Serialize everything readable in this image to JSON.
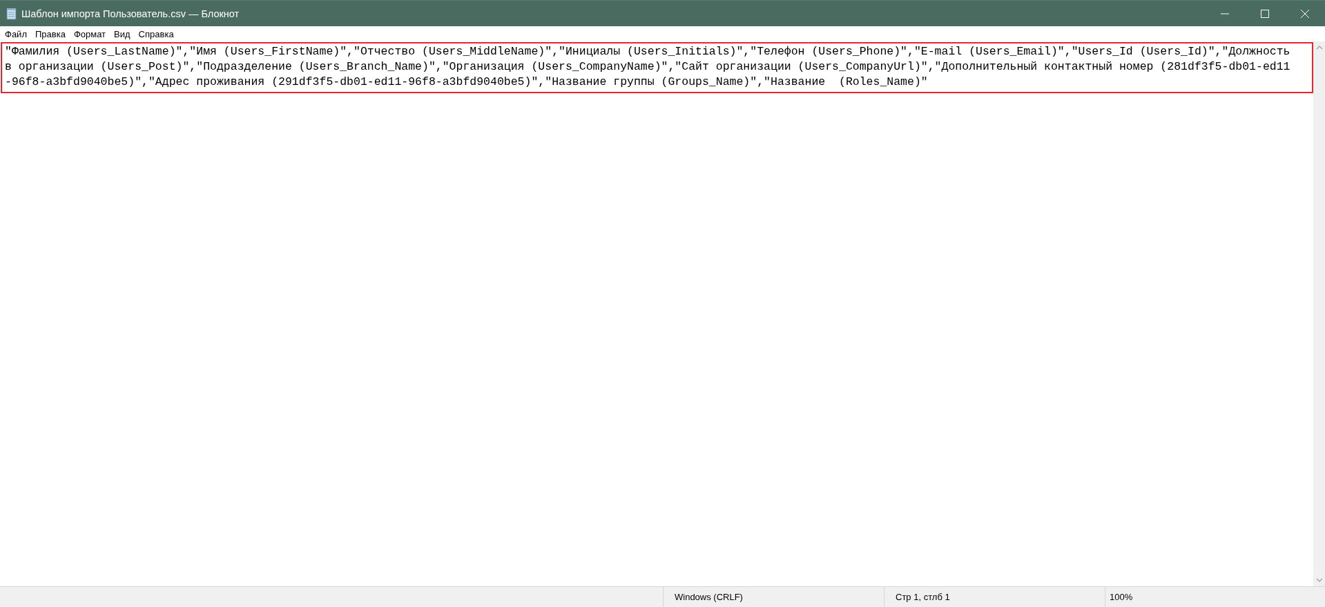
{
  "window": {
    "title": "Шаблон импорта Пользователь.csv — Блокнот"
  },
  "menu": [
    "Файл",
    "Правка",
    "Формат",
    "Вид",
    "Справка"
  ],
  "editor": {
    "lines": [
      "\"Фамилия (Users_LastName)\",\"Имя (Users_FirstName)\",\"Отчество (Users_MiddleName)\",\"Инициалы (Users_Initials)\",\"Телефон (Users_Phone)\",\"E-mail (Users_Email)\",\"Users_Id (Users_Id)\",\"Должность",
      "в организации (Users_Post)\",\"Подразделение (Users_Branch_Name)\",\"Организация (Users_CompanyName)\",\"Сайт организации (Users_CompanyUrl)\",\"Дополнительный контактный номер (281df3f5-db01-ed11",
      "-96f8-a3bfd9040be5)\",\"Адрес проживания (291df3f5-db01-ed11-96f8-a3bfd9040be5)\",\"Название группы (Groups_Name)\",\"Название  (Roles_Name)\""
    ]
  },
  "status_bar": {
    "line_ending": "Windows (CRLF)",
    "position": "Стр 1, стлб 1",
    "zoom": "100%"
  }
}
